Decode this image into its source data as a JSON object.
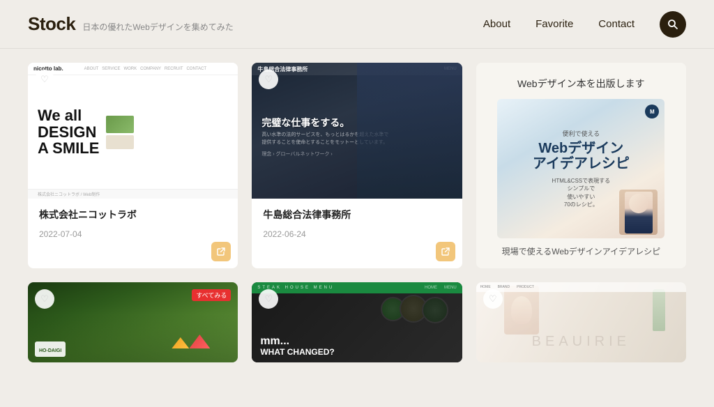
{
  "header": {
    "logo": "Stock",
    "tagline": "日本の優れたWebデザインを集めてみた",
    "nav": {
      "about": "About",
      "favorite": "Favorite",
      "contact": "Contact"
    }
  },
  "cards": [
    {
      "id": "card-1",
      "title": "株式会社ニコットラボ",
      "date": "2022-07-04",
      "type": "website",
      "headline_line1": "We all",
      "headline_line2": "DESIGN",
      "headline_line3": "A SMILE"
    },
    {
      "id": "card-2",
      "title": "牛島総合法律事務所",
      "date": "2022-06-24",
      "type": "law"
    },
    {
      "id": "card-3",
      "title": "Webデザイン本を出版します",
      "subtitle": "現場で使えるWebデザインアイデアレシピ",
      "book_title_line1": "Webデザイン",
      "book_title_line2": "アイデアレシピ",
      "book_sub": "HTML&CSSで表現するシンプルで使いやすい70のレシピ。",
      "type": "ad"
    }
  ],
  "second_row_cards": [
    {
      "id": "card-4",
      "type": "camp",
      "badge_text": "すべてみる"
    },
    {
      "id": "card-5",
      "type": "food",
      "text_line1": "mm...",
      "text_line2": "WHAT CHANGED?"
    },
    {
      "id": "card-6",
      "type": "beauty",
      "brand": "BEAUIRIE"
    }
  ]
}
